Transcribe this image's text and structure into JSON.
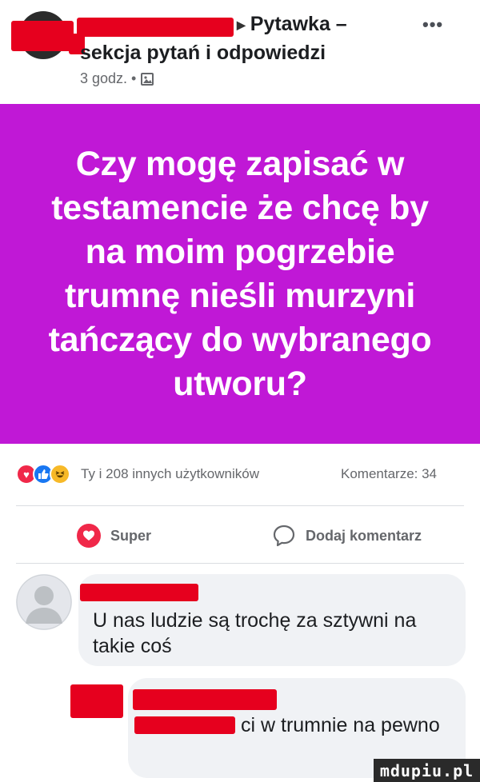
{
  "post": {
    "group_name": "Pytawka –",
    "group_subtitle": "sekcja pytań i odpowiedzi",
    "time": "3 godz. •",
    "more_label": "•••",
    "text": "Czy mogę zapisać w testamencie że chcę by na moim pogrzebie trumnę nieśli murzyni tańczący do wybranego utworu?",
    "card_color": "#c018d6"
  },
  "reactions": {
    "icons": [
      "love-icon",
      "like-icon",
      "haha-icon"
    ],
    "summary": "Ty i 208 innych użytkowników",
    "comments": "Komentarze: 34"
  },
  "actions": {
    "super_label": "Super",
    "comment_label": "Dodaj komentarz"
  },
  "comments": [
    {
      "text": "U nas ludzie są trochę za sztywni na takie coś"
    },
    {
      "text_tail": "ci w trumnie na pewno"
    }
  ],
  "watermark": "mdupiu.pl",
  "colors": {
    "redaction": "#e6001e",
    "love": "#f02849",
    "like": "#1877f2",
    "haha": "#f7b928"
  }
}
